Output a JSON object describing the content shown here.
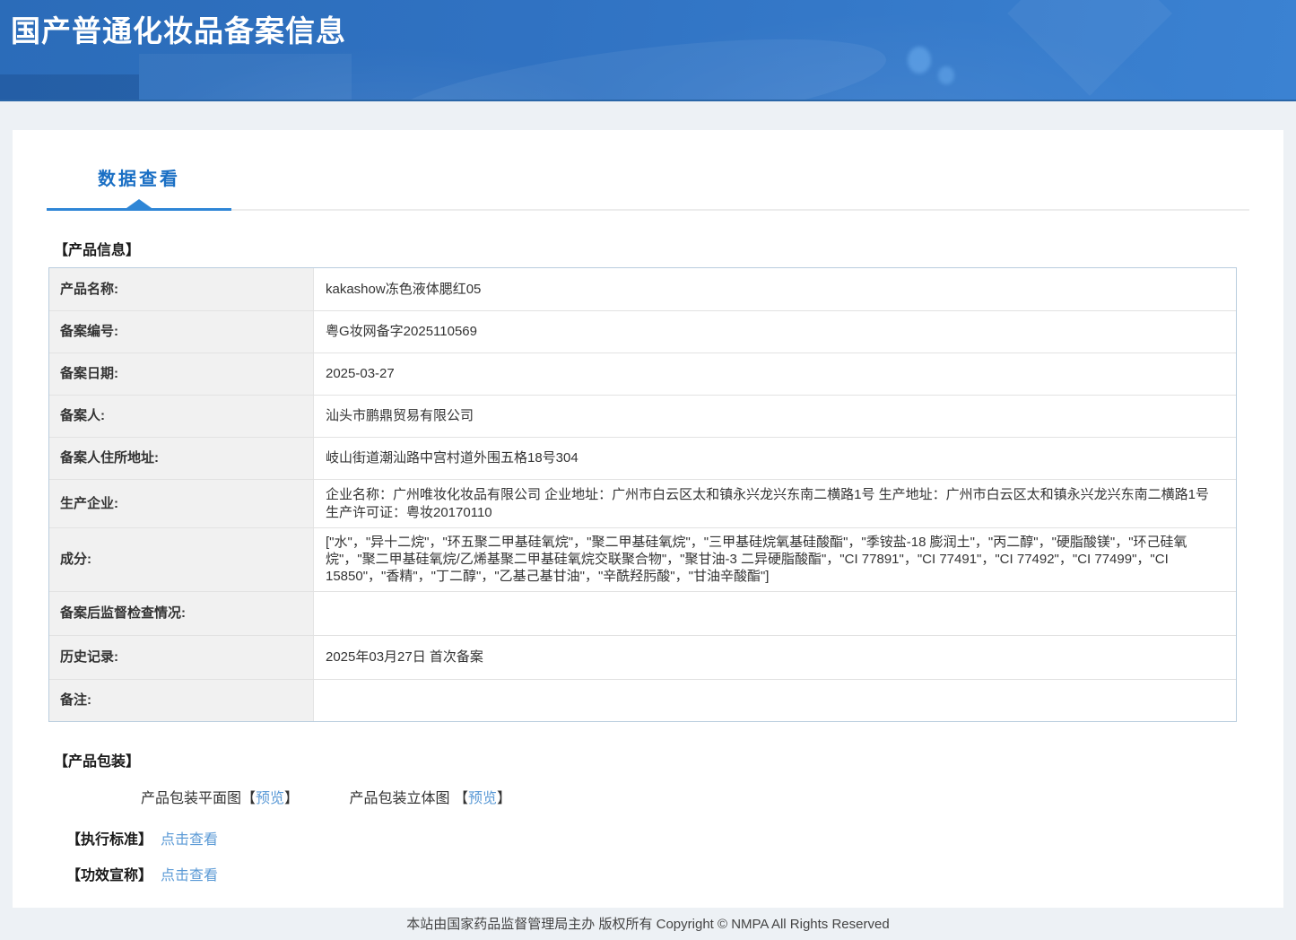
{
  "header": {
    "title": "国产普通化妆品备案信息"
  },
  "tab": {
    "label": "数据查看"
  },
  "sections": {
    "product_info_title": "【产品信息】",
    "packaging_title": "【产品包装】",
    "standards_title": "【执行标准】",
    "efficacy_title": "【功效宣称】"
  },
  "product_info": {
    "rows": [
      {
        "label": "产品名称:",
        "value": "kakashow冻色液体腮红05"
      },
      {
        "label": "备案编号:",
        "value": "粤G妆网备字2025110569"
      },
      {
        "label": "备案日期:",
        "value": "2025-03-27"
      },
      {
        "label": "备案人:",
        "value": "汕头市鹏鼎贸易有限公司"
      },
      {
        "label": "备案人住所地址:",
        "value": "岐山街道潮汕路中宫村道外围五格18号304"
      },
      {
        "label": "生产企业:",
        "value": "企业名称：广州唯妆化妆品有限公司 企业地址：广州市白云区太和镇永兴龙兴东南二横路1号 生产地址：广州市白云区太和镇永兴龙兴东南二横路1号 生产许可证：粤妆20170110"
      },
      {
        "label": "成分:",
        "value": "[\"水\"，\"异十二烷\"，\"环五聚二甲基硅氧烷\"，\"聚二甲基硅氧烷\"，\"三甲基硅烷氧基硅酸酯\"，\"季铵盐-18 膨润土\"，\"丙二醇\"，\"硬脂酸镁\"，\"环己硅氧烷\"，\"聚二甲基硅氧烷/乙烯基聚二甲基硅氧烷交联聚合物\"，\"聚甘油-3 二异硬脂酸酯\"，\"CI 77891\"，\"CI 77491\"，\"CI 77492\"，\"CI 77499\"，\"CI 15850\"，\"香精\"，\"丁二醇\"，\"乙基己基甘油\"，\"辛酰羟肟酸\"，\"甘油辛酸酯\"]"
      },
      {
        "label": "备案后监督检查情况:",
        "value": ""
      },
      {
        "label": "历史记录:",
        "value": "2025年03月27日 首次备案"
      },
      {
        "label": "备注:",
        "value": ""
      }
    ]
  },
  "packaging": {
    "flat_label": "产品包装平面图",
    "stereo_label": "产品包装立体图 ",
    "bracket_open": "【",
    "bracket_close": "】",
    "preview_label": "预览"
  },
  "links": {
    "view_label": "点击查看"
  },
  "footer": {
    "text": "本站由国家药品监督管理局主办 版权所有 Copyright © NMPA All Rights Reserved"
  },
  "colors": {
    "header_blue": "#3177c7",
    "header_border": "#2a66a8",
    "accent_blue": "#2f86d6",
    "tab_blue": "#1a6fc4",
    "link_blue": "#5b9ad6",
    "table_border": "#b9cdde",
    "label_bg": "#f1f1f1",
    "page_bg": "#edf1f5"
  }
}
